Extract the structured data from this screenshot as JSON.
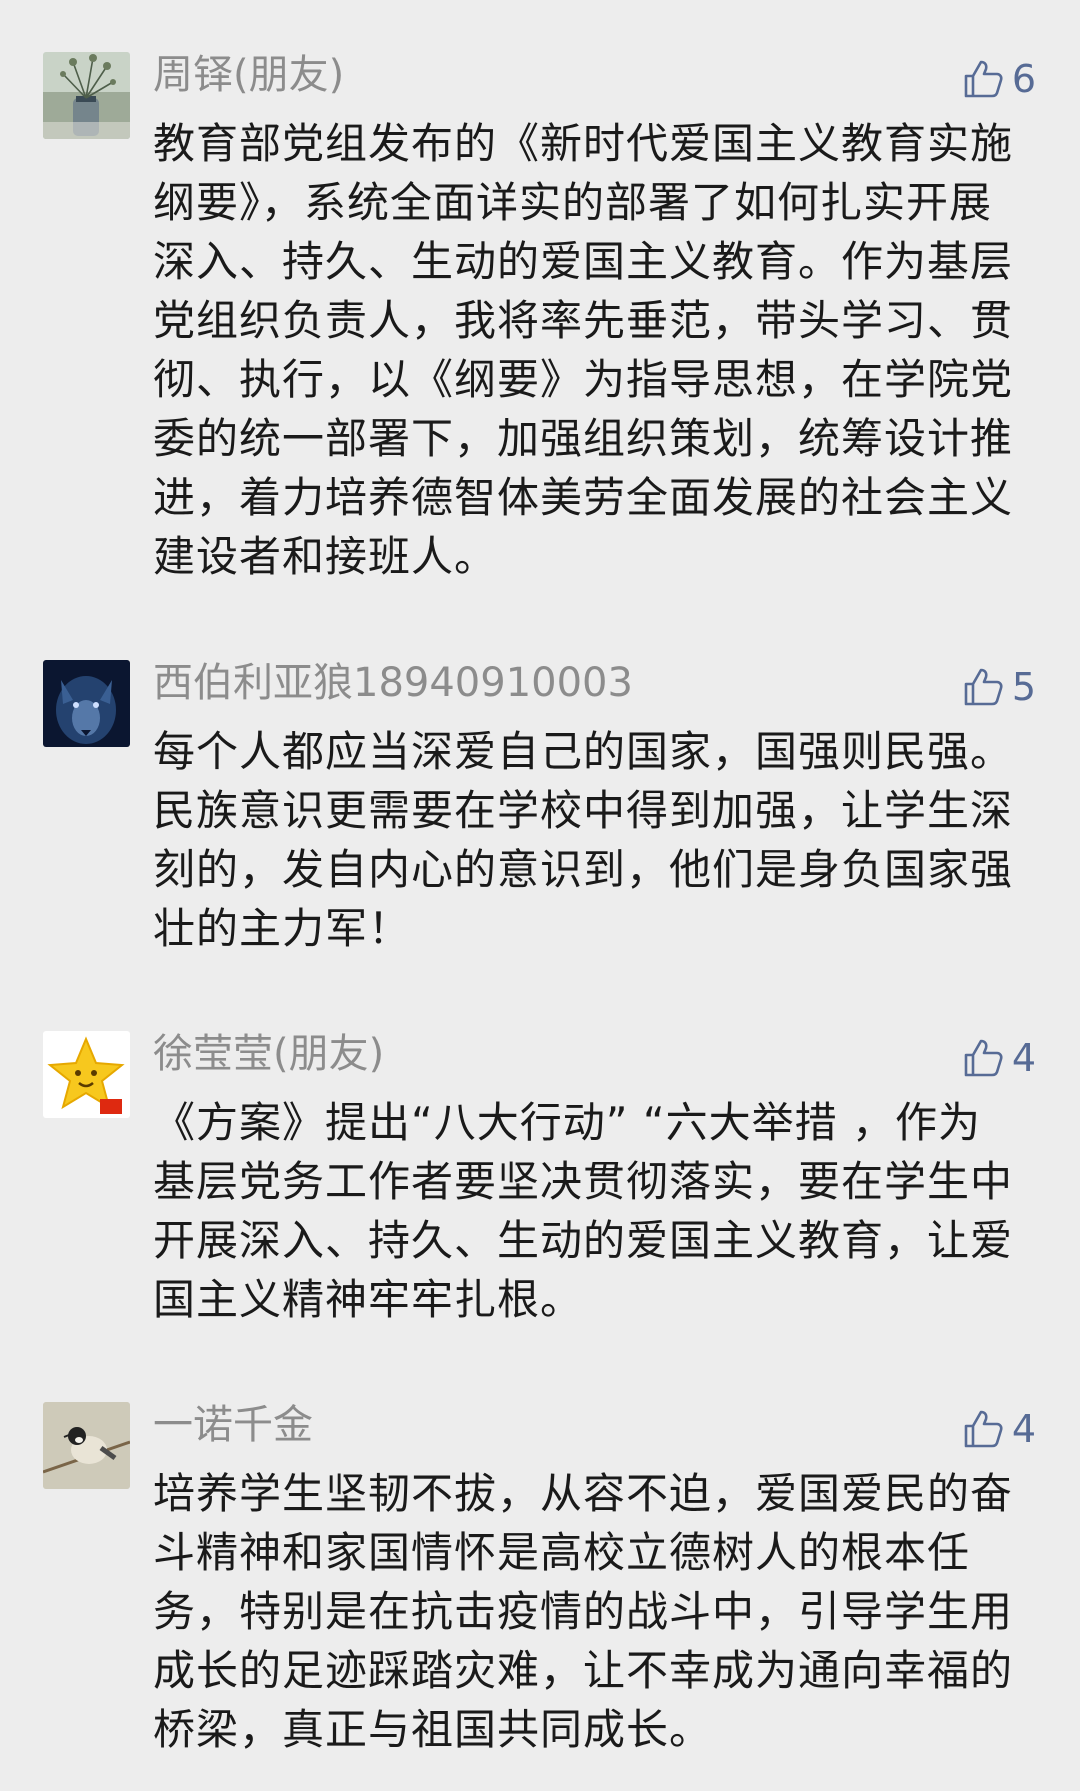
{
  "comments": [
    {
      "author": "周铎(朋友)",
      "likes": "6",
      "avatar": "flower-vase-photo",
      "text": "教育部党组发布的《新时代爱国主义教育实施纲要》，系统全面详实的部署了如何扎实开展深入、持久、生动的爱国主义教育。作为基层党组织负责人，我将率先垂范，带头学习、贯彻、执行，以《纲要》为指导思想，在学院党委的统一部署下，加强组织策划，统筹设计推进，着力培养德智体美劳全面发展的社会主义建设者和接班人。"
    },
    {
      "author": "西伯利亚狼18940910003",
      "likes": "5",
      "avatar": "wolf-photo",
      "text": "每个人都应当深爱自己的国家，国强则民强。民族意识更需要在学校中得到加强，让学生深刻的，发自内心的意识到，他们是身负国家强壮的主力军！"
    },
    {
      "author": "徐莹莹(朋友)",
      "likes": "4",
      "avatar": "smiling-star",
      "text": "《方案》提出“八大行动” “六大举措 ，作为基层党务工作者要坚决贯彻落实，要在学生中开展深入、持久、生动的爱国主义教育，让爱国主义精神牢牢扎根。"
    },
    {
      "author": "一诺千金",
      "likes": "4",
      "avatar": "bird-photo",
      "text": "培养学生坚韧不拔，从容不迫，爱国爱民的奋斗精神和家国情怀是高校立德树人的根本任务，特别是在抗击疫情的战斗中，引导学生用成长的足迹踩踏灾难，让不幸成为通向幸福的桥梁，真正与祖国共同成长。"
    }
  ]
}
